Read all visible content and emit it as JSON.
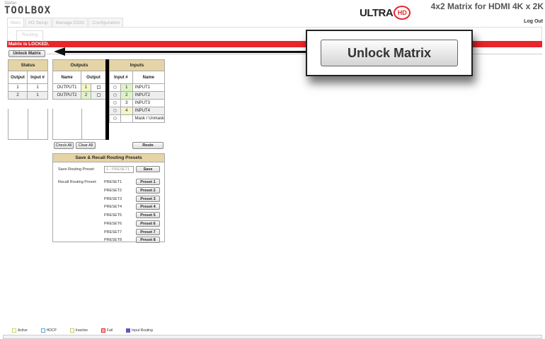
{
  "header": {
    "brand_small": "Stefan",
    "brand_big": "TOOLBOX",
    "ultra_text": "ULTRA",
    "ultra_hd": "HD",
    "product_title": "4x2 Matrix for HDMI 4K x 2K",
    "logout": "Log Out"
  },
  "main_tabs": [
    "Main",
    "I/O Setup",
    "Manage EDID",
    "Configuration"
  ],
  "sub_tab": "Routing",
  "lock_message": "Matrix is LOCKED.",
  "unlock_button_label": "Unlock Matrix",
  "callout": {
    "button_label": "Unlock Matrix"
  },
  "status_table": {
    "title": "Status",
    "headers": [
      "Output",
      "Input #"
    ],
    "rows": [
      {
        "output": "1",
        "input": "1"
      },
      {
        "output": "2",
        "input": "1"
      }
    ]
  },
  "outputs_table": {
    "title": "Outputs",
    "headers": [
      "Name",
      "Output"
    ],
    "rows": [
      {
        "name": "OUTPUT1",
        "num": "1"
      },
      {
        "name": "OUTPUT2",
        "num": "2"
      }
    ]
  },
  "inputs_table": {
    "title": "Inputs",
    "headers": [
      "Input #",
      "Name"
    ],
    "rows": [
      {
        "num": "1",
        "name": "INPUT1"
      },
      {
        "num": "2",
        "name": "INPUT2"
      },
      {
        "num": "3",
        "name": "INPUT3"
      },
      {
        "num": "4",
        "name": "INPUT4"
      },
      {
        "num": "",
        "name": "Mask / Unmask"
      }
    ]
  },
  "actions": {
    "check_all": "Check All",
    "clear_all": "Clear All",
    "route": "Route"
  },
  "presets": {
    "title": "Save & Recall Routing Presets",
    "save_label": "Save Routing Preset:",
    "save_selected": "1 - PRESET1",
    "save_button": "Save",
    "recall_label": "Recall Routing Preset:",
    "items": [
      {
        "name": "PRESET1",
        "button": "Preset 1"
      },
      {
        "name": "PRESET2",
        "button": "Preset 2"
      },
      {
        "name": "PRESET3",
        "button": "Preset 3"
      },
      {
        "name": "PRESET4",
        "button": "Preset 4"
      },
      {
        "name": "PRESET5",
        "button": "Preset 5"
      },
      {
        "name": "PRESET6",
        "button": "Preset 6"
      },
      {
        "name": "PRESET7",
        "button": "Preset 7"
      },
      {
        "name": "PRESET8",
        "button": "Preset 8"
      }
    ]
  },
  "legend": [
    {
      "label": "Active",
      "color": "#c8d86a"
    },
    {
      "label": "HDCP",
      "color": "#5aa5dc"
    },
    {
      "label": "Inactive",
      "color": "#c8c86a"
    },
    {
      "label": "Fail",
      "color": "#e8262c"
    },
    {
      "label": "Input Routing",
      "color": "#6a4fc0"
    }
  ],
  "colors": {
    "lock_bar": "#e8262c",
    "header_tan": "#e4d4a6",
    "input_num_bg": "#dff3c8",
    "output_num_bg": "#f4f5c8"
  }
}
